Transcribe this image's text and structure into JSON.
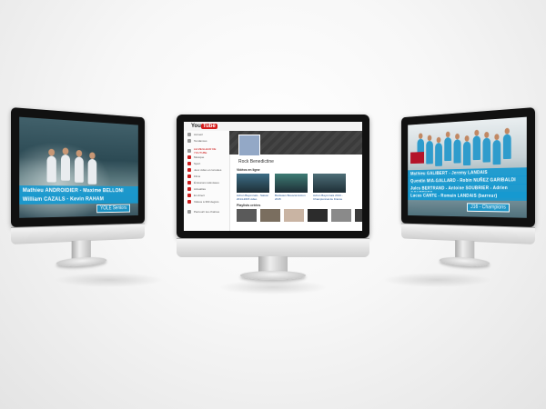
{
  "left_screen": {
    "caption_line1": "Mathieu ANDROIDIER - Maxime BELLONI",
    "caption_line2": "William CAZALS - Kevin RAHAM",
    "caption_small": "YOLE Seniors"
  },
  "center_screen": {
    "logo_text": "You",
    "logo_tube": "Tube",
    "channel_name": "Rock Benedictine",
    "section_uploads": "Vidéos en ligne",
    "section_playlists": "Playlists créées",
    "sidebar": [
      {
        "label": "Accueil",
        "red": false
      },
      {
        "label": "Tendances",
        "red": false
      },
      {
        "label": "LE MEILLEUR DE YOUTUBE",
        "red": false
      },
      {
        "label": "Musique",
        "red": true
      },
      {
        "label": "Sport",
        "red": true
      },
      {
        "label": "Jeux vidéo et consoles",
        "red": true
      },
      {
        "label": "Films",
        "red": true
      },
      {
        "label": "Émissions télévisées",
        "red": true
      },
      {
        "label": "Actualités",
        "red": true
      },
      {
        "label": "En direct",
        "red": true
      },
      {
        "label": "Vidéos à 360 degrés",
        "red": true
      },
      {
        "label": "Parcourir les chaînes",
        "red": false
      }
    ],
    "subscribe_label": "Se connecter",
    "uploads": [
      {
        "title": "Aviron Bayonnais - Saison 2014-2015 vidéo",
        "color": "#3d6d86"
      },
      {
        "title": "Bordeaux Bouscat Aviron 2015",
        "color": "#3e7c74"
      },
      {
        "title": "Aviron Bayonnais 2013 - Championnat de France",
        "color": "#4d6e77"
      }
    ],
    "playlists_colors": [
      "#5a5a5a",
      "#7a6e5f",
      "#c9b4a3",
      "#2c2c2c",
      "#8a8a8a",
      "#3b3b3b",
      "#e0b58a"
    ]
  },
  "right_screen": {
    "caption_line1": "Mathieu GALIBERT - Jeremy LANDAIS",
    "caption_line2": "Quentin MIA-GALLARD - Robin NUÑEZ GARIBALDI",
    "caption_line3": "Jules BERTRAND - Antoine SOUBRIER - Adrien GOUZENES",
    "caption_line4": "Lucas CANTE - Romain LANDAIS (barreur)",
    "caption_small": "J16 - Champions"
  }
}
